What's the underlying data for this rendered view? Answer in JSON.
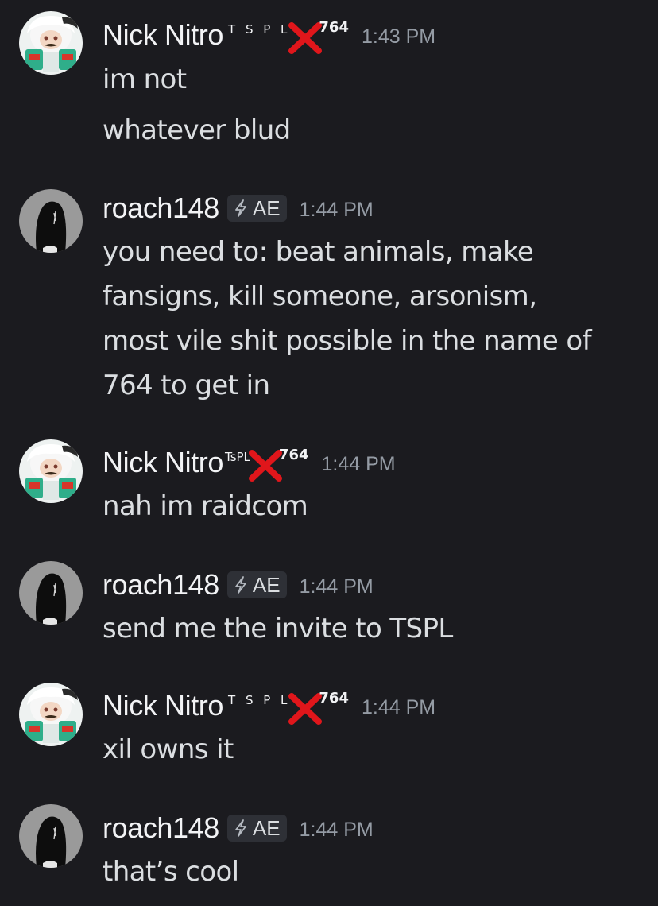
{
  "users": {
    "nick": {
      "name": "Nick Nitro",
      "tag_letters": "T S P L",
      "tag_letters_compact": "TsPL",
      "tag_number": "764",
      "avatar_icon": "anime-character-avatar"
    },
    "roach": {
      "name": "roach148",
      "badge_text": "AE",
      "badge_icon": "lightning-bolt-icon",
      "avatar_icon": "dark-hooded-figure-avatar"
    }
  },
  "messages": [
    {
      "author": "Nick Nitro",
      "time": "1:43 PM",
      "lines": [
        "im not",
        "whatever blud"
      ]
    },
    {
      "author": "roach148",
      "time": "1:44 PM",
      "lines": [
        "you need to: beat animals, make",
        "fansigns, kill someone, arsonism,",
        "most vile shit possible in the name of",
        "764 to get in"
      ]
    },
    {
      "author": "Nick Nitro",
      "time": "1:44 PM",
      "lines": [
        "nah im raidcom"
      ]
    },
    {
      "author": "roach148",
      "time": "1:44 PM",
      "lines": [
        "send me the invite to TSPL"
      ]
    },
    {
      "author": "Nick Nitro",
      "time": "1:44 PM",
      "lines": [
        "xil owns it"
      ]
    },
    {
      "author": "roach148",
      "time": "1:44 PM",
      "lines": [
        "that’s cool"
      ]
    }
  ],
  "colors": {
    "background": "#1b1b1f",
    "username": "#f2f3f5",
    "message_text": "#dbdee1",
    "timestamp": "#949ba4",
    "badge_bg": "#2e3036",
    "x_mark": "#e0161b"
  }
}
